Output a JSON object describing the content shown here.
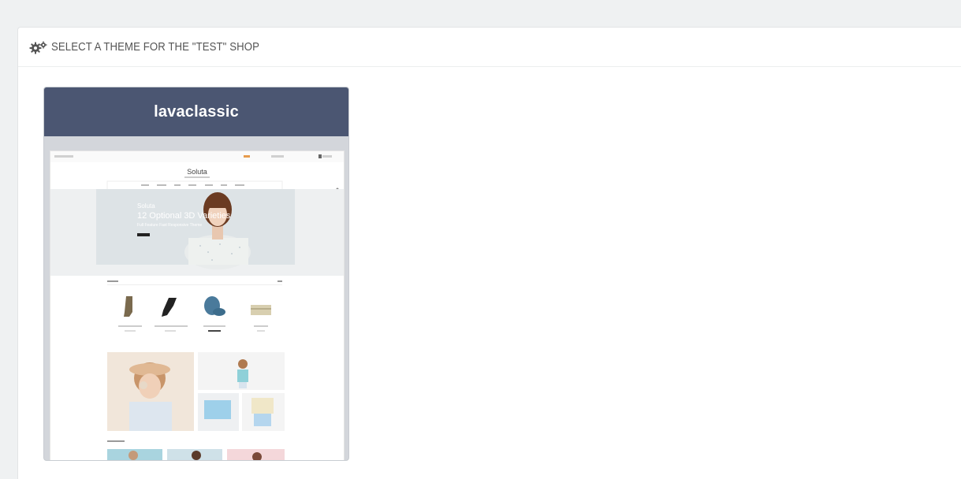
{
  "panel": {
    "title": "SELECT A THEME FOR THE \"TEST\" SHOP",
    "icon": "cogs-icon"
  },
  "theme": {
    "name": "lavaclassic",
    "preview": {
      "logo": "Soluta",
      "banner_title": "Soluta",
      "banner_subtitle": "12 Optional 3D Varieties",
      "banner_line": "Full Feature Fast Responsive Theme"
    }
  },
  "colors": {
    "page_bg": "#eff1f2",
    "theme_header": "#4b5672",
    "card_bg": "#d3d6db"
  }
}
